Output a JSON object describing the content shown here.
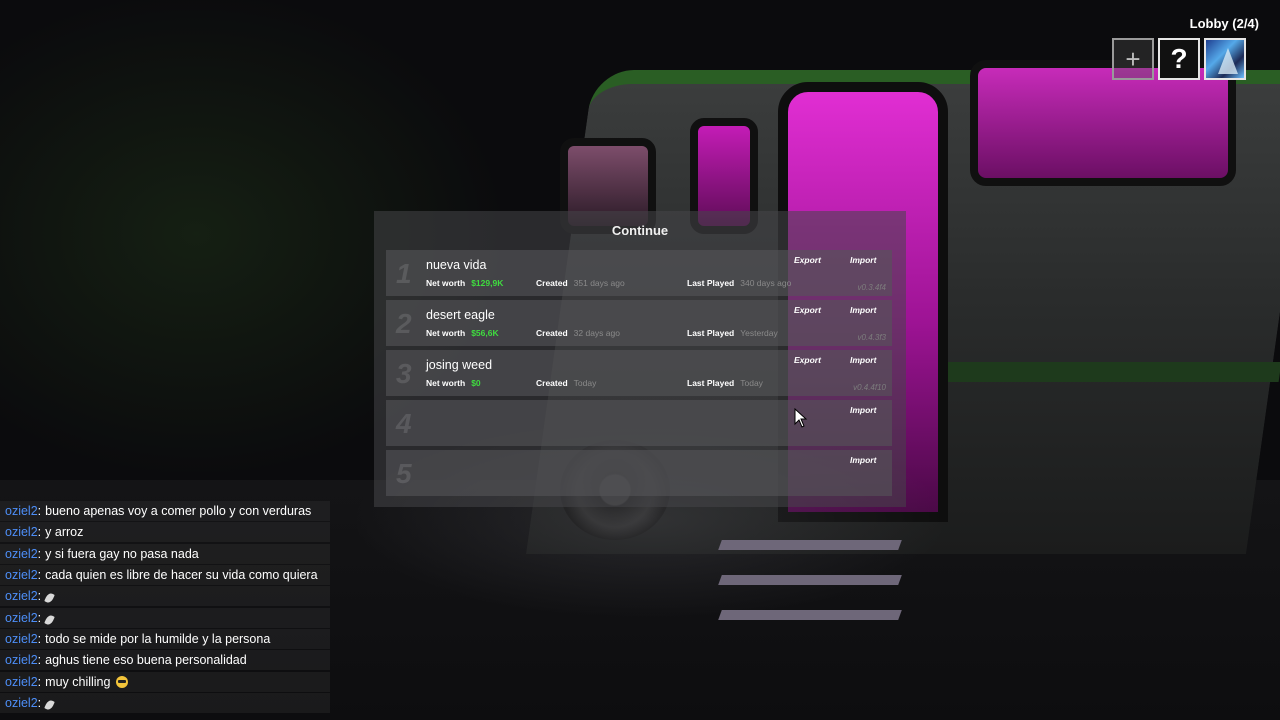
{
  "lobby": {
    "label": "Lobby (2/4)",
    "add_glyph": "+",
    "help_glyph": "?"
  },
  "continue_panel": {
    "title": "Continue",
    "labels": {
      "net_worth": "Net worth",
      "created": "Created",
      "last_played": "Last Played",
      "export": "Export",
      "import": "Import"
    },
    "saves": [
      {
        "num": "1",
        "name": "nueva vida",
        "net_worth": "$129,9K",
        "created": "351 days ago",
        "last_played": "340 days ago",
        "version": "v0.3.4f4",
        "has_export": true
      },
      {
        "num": "2",
        "name": "desert eagle",
        "net_worth": "$56,6K",
        "created": "32 days ago",
        "last_played": "Yesterday",
        "version": "v0.4.3f3",
        "has_export": true
      },
      {
        "num": "3",
        "name": "josing weed",
        "net_worth": "$0",
        "created": "Today",
        "last_played": "Today",
        "version": "v0.4.4f10",
        "has_export": true
      },
      {
        "num": "4",
        "empty": true
      },
      {
        "num": "5",
        "empty": true
      }
    ]
  },
  "chat": {
    "messages": [
      {
        "user": "oziel2",
        "text": "bueno apenas voy a comer pollo y con verduras"
      },
      {
        "user": "oziel2",
        "text": "y arroz"
      },
      {
        "user": "oziel2",
        "text": "y si fuera gay no pasa nada"
      },
      {
        "user": "oziel2",
        "text": "cada quien es libre de hacer su vida como quiera"
      },
      {
        "user": "oziel2",
        "text": "",
        "emoji": "feather-emoji"
      },
      {
        "user": "oziel2",
        "text": "",
        "emoji": "feather-emoji"
      },
      {
        "user": "oziel2",
        "text": "todo se mide por la humilde y la persona"
      },
      {
        "user": "oziel2",
        "text": "aghus tiene eso buena personalidad"
      },
      {
        "user": "oziel2",
        "text": "muy chilling",
        "emoji": "sunglasses-emoji"
      },
      {
        "user": "oziel2",
        "text": "",
        "emoji": "feather-emoji"
      }
    ]
  },
  "colors": {
    "username": "#4d8ef7",
    "money": "#3fdc3f",
    "pink_light": "#e12ed3"
  }
}
